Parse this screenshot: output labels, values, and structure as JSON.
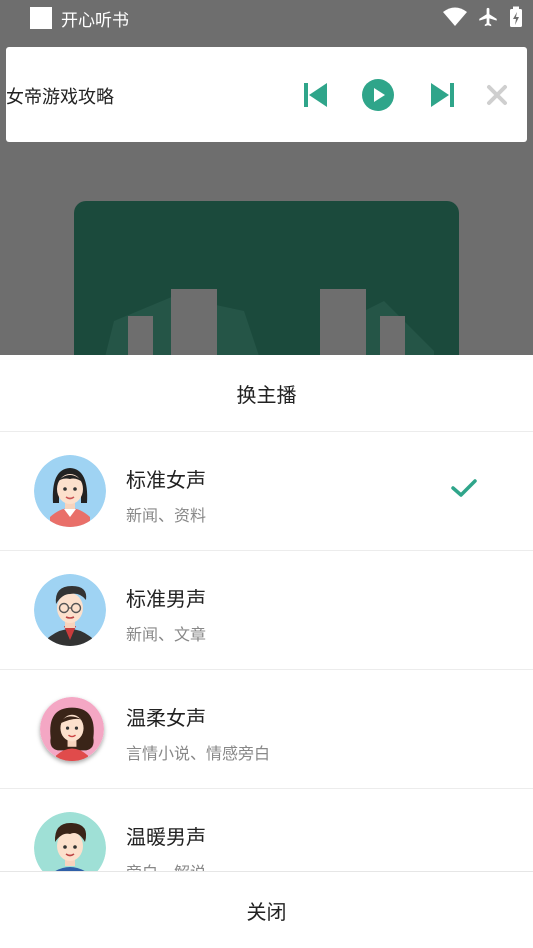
{
  "status_bar": {
    "app_name": "开心听书"
  },
  "player": {
    "title": "女帝游戏攻略",
    "accent": "#2fa58a"
  },
  "sheet": {
    "title": "换主播",
    "items": [
      {
        "name": "标准女声",
        "desc": "新闻、资料",
        "selected": true
      },
      {
        "name": "标准男声",
        "desc": "新闻、文章",
        "selected": false
      },
      {
        "name": "温柔女声",
        "desc": "言情小说、情感旁白",
        "selected": false
      },
      {
        "name": "温暖男声",
        "desc": "旁白、解说",
        "selected": false
      }
    ],
    "close_label": "关闭"
  }
}
